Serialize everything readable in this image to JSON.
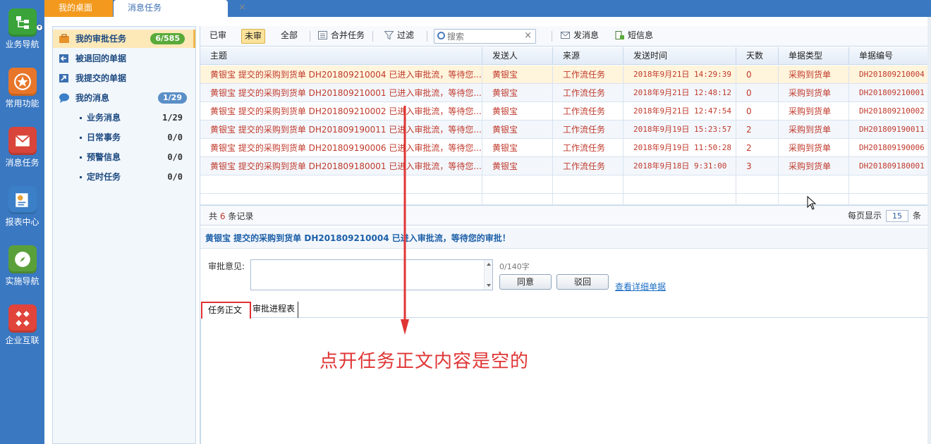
{
  "launcher": {
    "items": [
      {
        "label": "业务导航",
        "icon": "org-chart-icon",
        "color": "#3aa33a"
      },
      {
        "label": "常用功能",
        "icon": "star-icon",
        "color": "#e8762a"
      },
      {
        "label": "消息任务",
        "icon": "mail-icon",
        "color": "#d9453a"
      },
      {
        "label": "报表中心",
        "icon": "report-icon",
        "color": "#3a7fc7"
      },
      {
        "label": "实施导航",
        "icon": "compass-icon",
        "color": "#5aa03a"
      },
      {
        "label": "企业互联",
        "icon": "diamonds-icon",
        "color": "#e0443a"
      }
    ]
  },
  "tabs": {
    "home": "我的桌面",
    "active": "消息任务",
    "close": "×"
  },
  "left_panel": {
    "items": [
      {
        "label": "我的审批任务",
        "badge": "6/585",
        "badge_color": "#5aaa3a",
        "icon": "briefcase-icon"
      },
      {
        "label": "被退回的单据",
        "icon": "return-icon"
      },
      {
        "label": "我提交的单据",
        "icon": "submit-icon"
      },
      {
        "label": "我的消息",
        "badge": "1/29",
        "badge_color": "#5a8fc7",
        "icon": "chat-bubble-icon"
      }
    ],
    "sub_items": [
      {
        "label": "业务消息",
        "count": "1/29"
      },
      {
        "label": "日常事务",
        "count": "0/0"
      },
      {
        "label": "预警信息",
        "count": "0/0"
      },
      {
        "label": "定时任务",
        "count": "0/0"
      }
    ]
  },
  "toolbar": {
    "read": "已审",
    "unread": "未审",
    "all": "全部",
    "merge": "合并任务",
    "filter": "过滤",
    "search_placeholder": "搜索",
    "send_message": "发消息",
    "sms": "短信息"
  },
  "grid": {
    "columns": [
      "主题",
      "发送人",
      "来源",
      "发送时间",
      "天数",
      "单据类型",
      "单据编号"
    ],
    "rows": [
      {
        "subject": "黄银宝 提交的采购到货单 DH201809210004 已进入审批流，等待您...",
        "sender": "黄银宝",
        "source": "工作流任务",
        "time": "2018年9月21日 14:29:39",
        "days": "0",
        "type": "采购到货单",
        "code": "DH201809210004"
      },
      {
        "subject": "黄银宝 提交的采购到货单 DH201809210001 已进入审批流，等待您...",
        "sender": "黄银宝",
        "source": "工作流任务",
        "time": "2018年9月21日 12:48:12",
        "days": "0",
        "type": "采购到货单",
        "code": "DH201809210001"
      },
      {
        "subject": "黄银宝 提交的采购到货单 DH201809210002 已进入审批流，等待您...",
        "sender": "黄银宝",
        "source": "工作流任务",
        "time": "2018年9月21日 12:47:54",
        "days": "0",
        "type": "采购到货单",
        "code": "DH201809210002"
      },
      {
        "subject": "黄银宝 提交的采购到货单 DH201809190011 已进入审批流，等待您...",
        "sender": "黄银宝",
        "source": "工作流任务",
        "time": "2018年9月19日 15:23:57",
        "days": "2",
        "type": "采购到货单",
        "code": "DH201809190011"
      },
      {
        "subject": "黄银宝 提交的采购到货单 DH201809190006 已进入审批流，等待您...",
        "sender": "黄银宝",
        "source": "工作流任务",
        "time": "2018年9月19日 11:50:28",
        "days": "2",
        "type": "采购到货单",
        "code": "DH201809190006"
      },
      {
        "subject": "黄银宝 提交的采购到货单 DH201809180001 已进入审批流，等待您...",
        "sender": "黄银宝",
        "source": "工作流任务",
        "time": "2018年9月18日 9:31:00",
        "days": "3",
        "type": "采购到货单",
        "code": "DH201809180001"
      }
    ]
  },
  "pager": {
    "prefix": "共",
    "count": "6",
    "suffix": "条记录",
    "per_page_label": "每页显示",
    "per_page": "15",
    "unit": "条"
  },
  "detail": {
    "title": "黄银宝 提交的采购到货单 DH201809210004 已进入审批流，等待您的审批！",
    "approve_label": "审批意见:",
    "char_count": "0/140字",
    "agree": "同意",
    "reject": "驳回",
    "view_link": "查看详细单据",
    "tab_body": "任务正文",
    "tab_progress": "审批进程表"
  },
  "annotation": "点开任务正文内容是空的",
  "colors": {
    "accent_red": "#e03535",
    "brand_blue": "#3a78c2",
    "row_text": "#c0392b"
  }
}
